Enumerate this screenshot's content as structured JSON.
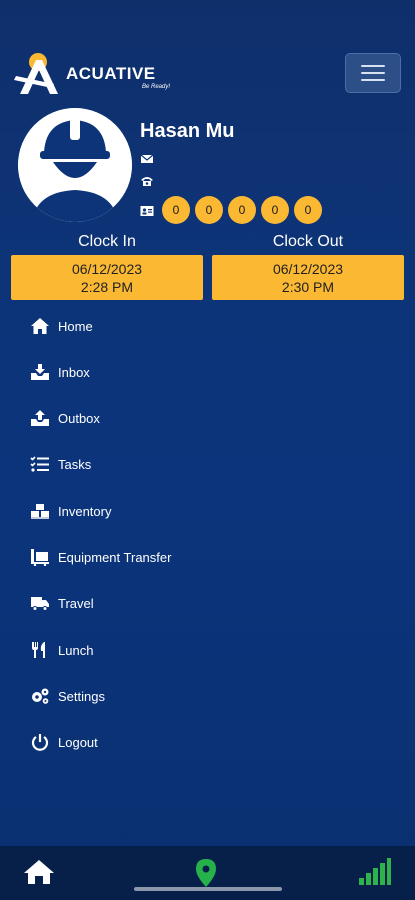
{
  "header": {
    "brand": "ACUATIVE",
    "tagline": "Be Ready!"
  },
  "profile": {
    "name": "Hasan Mu",
    "counters": [
      "0",
      "0",
      "0",
      "0",
      "0"
    ]
  },
  "clock": {
    "in_label": "Clock In",
    "in_date": "06/12/2023",
    "in_time": "2:28 PM",
    "out_label": "Clock Out",
    "out_date": "06/12/2023",
    "out_time": "2:30 PM"
  },
  "menu": {
    "items": [
      {
        "label": "Home",
        "icon": "home-icon"
      },
      {
        "label": "Inbox",
        "icon": "inbox-icon"
      },
      {
        "label": "Outbox",
        "icon": "outbox-icon"
      },
      {
        "label": "Tasks",
        "icon": "tasks-icon"
      },
      {
        "label": "Inventory",
        "icon": "inventory-icon"
      },
      {
        "label": "Equipment Transfer",
        "icon": "pallet-icon"
      },
      {
        "label": "Travel",
        "icon": "truck-icon"
      },
      {
        "label": "Lunch",
        "icon": "utensils-icon"
      },
      {
        "label": "Settings",
        "icon": "gears-icon"
      },
      {
        "label": "Logout",
        "icon": "power-icon"
      }
    ]
  },
  "bottom_nav": {
    "icons": [
      "home-icon",
      "location-pin-icon",
      "signal-icon"
    ]
  },
  "colors": {
    "accent": "#fbb833",
    "location": "#27b14a",
    "signal": "#2fb24b"
  }
}
